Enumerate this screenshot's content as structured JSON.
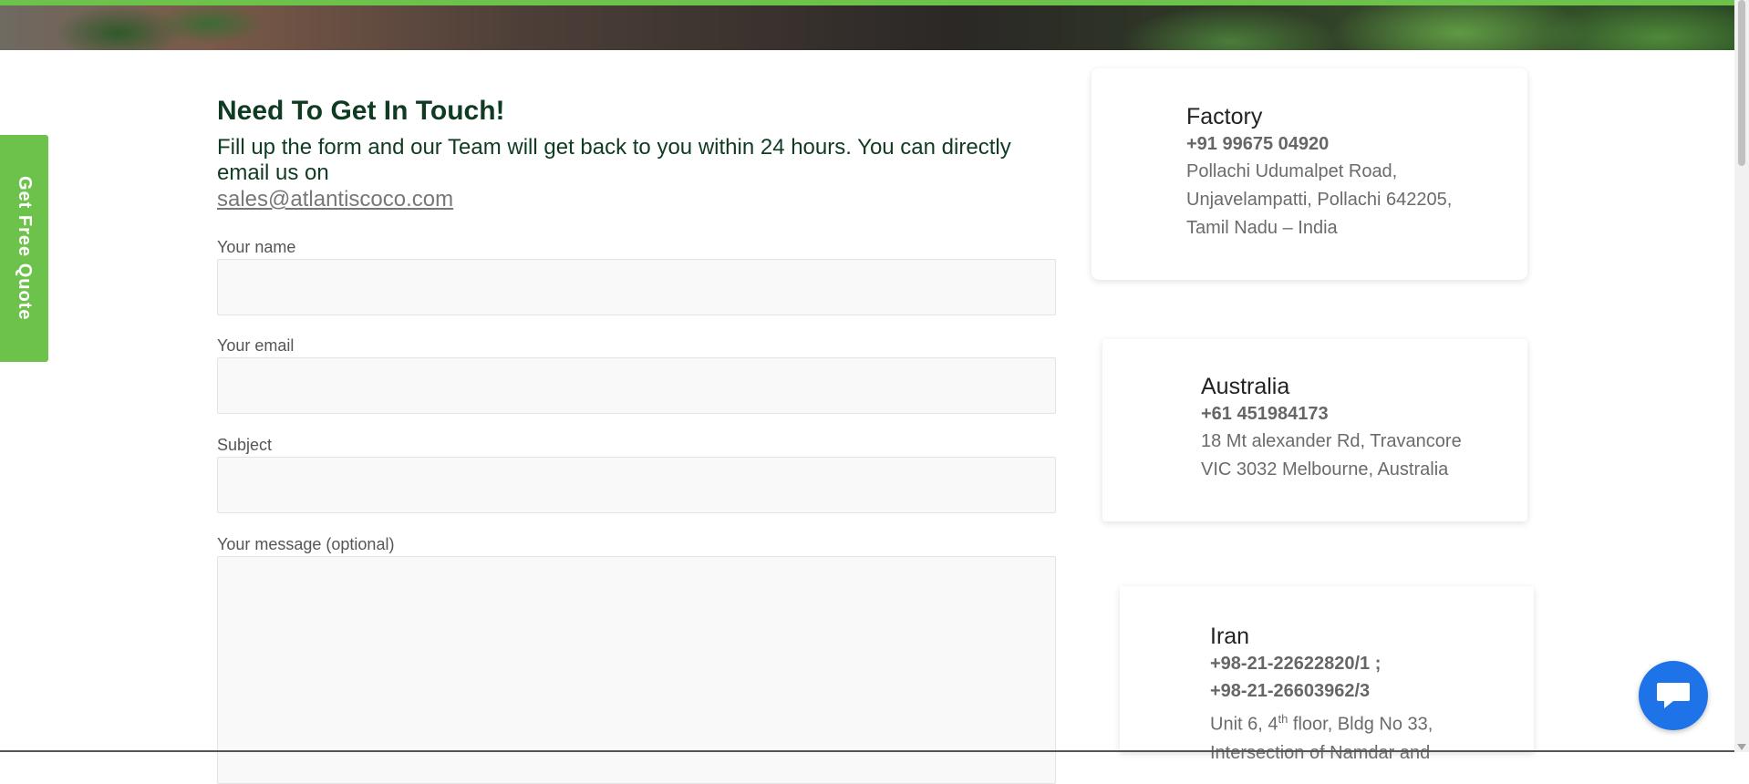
{
  "quote_tab": {
    "label": "Get Free Quote"
  },
  "contact": {
    "heading": "Need To Get In Touch!",
    "intro": "Fill up the form and our Team will get back to you within 24 hours. You can directly email us on",
    "email": "sales@atlantiscoco.com"
  },
  "form": {
    "name_label": "Your name",
    "email_label": "Your email",
    "subject_label": "Subject",
    "message_label": "Your message (optional)"
  },
  "offices": [
    {
      "title": "Factory",
      "phones": [
        "+91 99675 04920"
      ],
      "address": [
        "Pollachi Udumalpet Road,",
        "Unjavelampatti, Pollachi 642205,",
        "Tamil Nadu – India"
      ]
    },
    {
      "title": "Australia",
      "phones": [
        "+61 451984173"
      ],
      "address": [
        "18 Mt alexander Rd, Travancore",
        "VIC 3032 Melbourne, Australia"
      ]
    },
    {
      "title": "Iran",
      "phones": [
        "+98-21-22622820/1 ;",
        "+98-21-26603962/3"
      ],
      "address_line1_pre": "Unit 6, 4",
      "address_line1_sup": "th",
      "address_line1_post": " floor, Bldg No 33,",
      "address_line2": "Intersection of Namdar and"
    }
  ],
  "icons": {
    "chat": "chat-bubble-icon",
    "scroll": "scroll-down-arrow-icon"
  },
  "colors": {
    "accent_green": "#6cc24a",
    "heading_green": "#0f3b22",
    "chat_blue": "#1e73e8"
  }
}
